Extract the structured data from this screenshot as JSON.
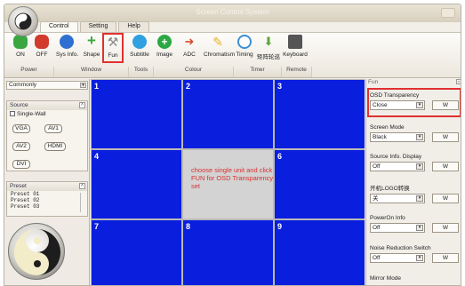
{
  "window": {
    "title": "Screen Control System"
  },
  "tabs": [
    "Control",
    "Setting",
    "Help"
  ],
  "toolbar": {
    "tools": [
      {
        "label": "ON",
        "icon": "toggle-on-icon",
        "color": "#3aa640"
      },
      {
        "label": "OFF",
        "icon": "toggle-off-icon",
        "color": "#d23b2b"
      },
      {
        "label": "Sys Info.",
        "icon": "info-icon",
        "color": "#2f6fd1"
      },
      {
        "label": "Shape",
        "icon": "plus-shape-icon",
        "color": "#39a63a"
      },
      {
        "label": "Fun",
        "icon": "wrench-icon",
        "color": "#9a9a9a"
      },
      {
        "label": "Subtitle",
        "icon": "speech-bubble-icon",
        "color": "#2fa0e0"
      },
      {
        "label": "Image",
        "icon": "plus-image-icon",
        "color": "#2ba844"
      },
      {
        "label": "ADC",
        "icon": "adc-arrow-icon",
        "color": "#d94a2b"
      },
      {
        "label": "Chromatism",
        "icon": "pencil-icon",
        "color": "#e8b22a"
      },
      {
        "label": "Timing",
        "icon": "clock-icon",
        "color": "#3c8fd1"
      },
      {
        "label": "矩阵轮巡",
        "icon": "matrix-arrow-icon",
        "color": "#57a83a"
      },
      {
        "label": "Keyboard",
        "icon": "keyboard-icon",
        "color": "#555555"
      }
    ],
    "groups": [
      "Power",
      "Window",
      "Tools",
      "Colour",
      "Timer",
      "Remote"
    ]
  },
  "left": {
    "mode_combo": "Commonly",
    "source_title": "Source",
    "single_wall": "Single-Wall",
    "sources": [
      "VGA",
      "AV1",
      "AV2",
      "HDMI",
      "DVI"
    ],
    "preset_title": "Preset",
    "presets": [
      "Preset 01",
      "Preset 02",
      "Preset 03"
    ]
  },
  "wall": {
    "cells": [
      "1",
      "2",
      "3",
      "4",
      "",
      "6",
      "7",
      "8",
      "9"
    ],
    "hint": "choose single unit and click FUN for OSD Transparency set"
  },
  "right": {
    "panel_title": "Fun",
    "settings": [
      {
        "label": "OSD Transparency",
        "value": "Close",
        "button": "W"
      },
      {
        "label": "Screen Mode",
        "value": "Black",
        "button": "W"
      },
      {
        "label": "Source Info. Display",
        "value": "Off",
        "button": "W"
      },
      {
        "label": "开机LOGO转换",
        "value": "关",
        "button": "W"
      },
      {
        "label": "PowerOn Info",
        "value": "Off",
        "button": "W"
      },
      {
        "label": "Noise Reduction Switch",
        "value": "Off",
        "button": "W"
      },
      {
        "label": "Mirror Mode",
        "value": "",
        "button": ""
      }
    ]
  },
  "colors": {
    "wall_blue": "#0a1ede",
    "highlight_red": "#e03030",
    "selected_cell": "#d3d3d3"
  }
}
